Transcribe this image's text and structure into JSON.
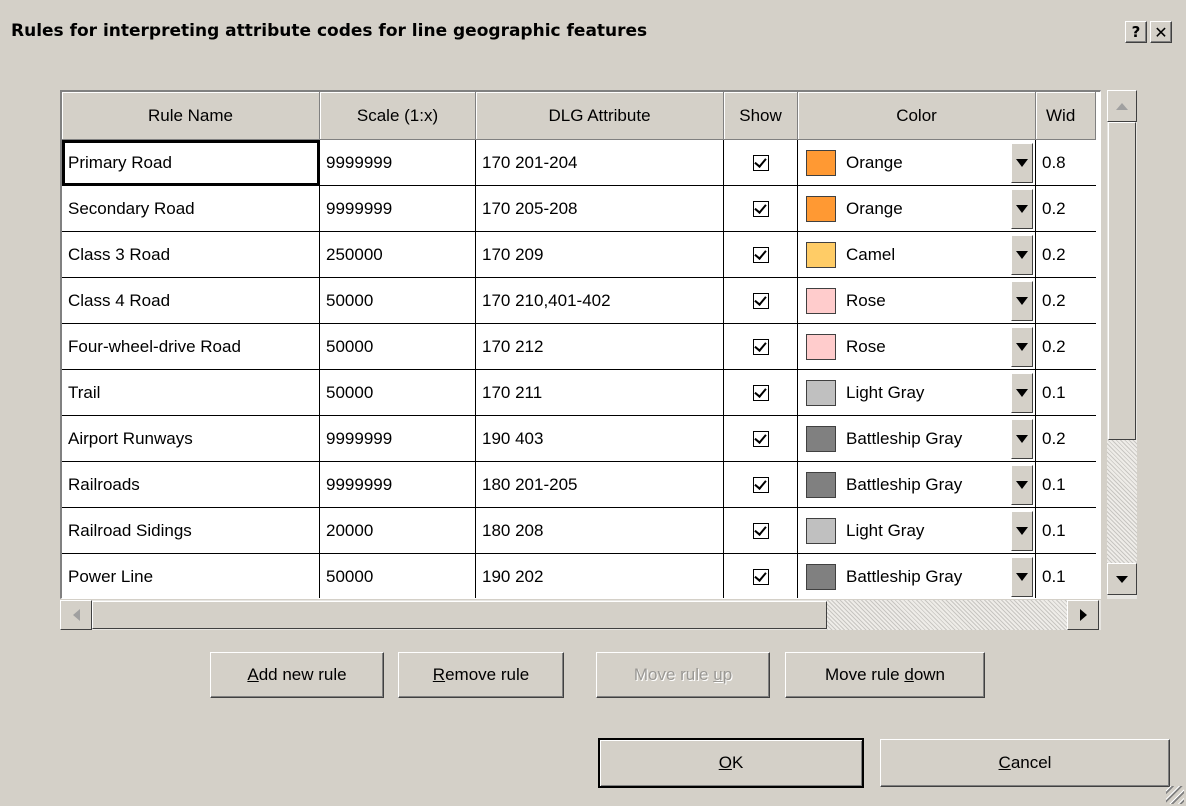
{
  "dialog": {
    "title": "Rules for interpreting attribute codes for line geographic features",
    "help_label": "?",
    "close_label": "✕"
  },
  "grid": {
    "columns": [
      "Rule Name",
      "Scale (1:x)",
      "DLG Attribute",
      "Show",
      "Color",
      "Wid"
    ],
    "rows": [
      {
        "name": "Primary Road",
        "scale": "9999999",
        "attribute": "170 201-204",
        "show": true,
        "color": "Orange",
        "swatch": "#ff9933",
        "width": "0.8"
      },
      {
        "name": "Secondary Road",
        "scale": "9999999",
        "attribute": "170 205-208",
        "show": true,
        "color": "Orange",
        "swatch": "#ff9933",
        "width": "0.2"
      },
      {
        "name": "Class 3 Road",
        "scale": "250000",
        "attribute": "170 209",
        "show": true,
        "color": "Camel",
        "swatch": "#ffcc66",
        "width": "0.2"
      },
      {
        "name": "Class 4 Road",
        "scale": "50000",
        "attribute": "170 210,401-402",
        "show": true,
        "color": "Rose",
        "swatch": "#ffcccc",
        "width": "0.2"
      },
      {
        "name": "Four-wheel-drive Road",
        "scale": "50000",
        "attribute": "170 212",
        "show": true,
        "color": "Rose",
        "swatch": "#ffcccc",
        "width": "0.2"
      },
      {
        "name": "Trail",
        "scale": "50000",
        "attribute": "170 211",
        "show": true,
        "color": "Light Gray",
        "swatch": "#c0c0c0",
        "width": "0.1"
      },
      {
        "name": "Airport Runways",
        "scale": "9999999",
        "attribute": "190 403",
        "show": true,
        "color": "Battleship Gray",
        "swatch": "#808080",
        "width": "0.2"
      },
      {
        "name": "Railroads",
        "scale": "9999999",
        "attribute": "180 201-205",
        "show": true,
        "color": "Battleship Gray",
        "swatch": "#808080",
        "width": "0.1"
      },
      {
        "name": "Railroad Sidings",
        "scale": "20000",
        "attribute": "180 208",
        "show": true,
        "color": "Light Gray",
        "swatch": "#c0c0c0",
        "width": "0.1"
      },
      {
        "name": "Power Line",
        "scale": "50000",
        "attribute": "190 202",
        "show": true,
        "color": "Battleship Gray",
        "swatch": "#808080",
        "width": "0.1"
      }
    ]
  },
  "buttons": {
    "add_rule": {
      "mnemonic": "A",
      "rest": "dd new rule"
    },
    "remove_rule": {
      "mnemonic": "R",
      "rest": "emove rule"
    },
    "move_up": {
      "pre": "Move rule ",
      "mnemonic": "u",
      "rest": "p"
    },
    "move_down": {
      "pre": "Move rule ",
      "mnemonic": "d",
      "rest": "own"
    },
    "ok": {
      "mnemonic": "O",
      "rest": "K"
    },
    "cancel": {
      "mnemonic": "C",
      "rest": "ancel"
    }
  }
}
